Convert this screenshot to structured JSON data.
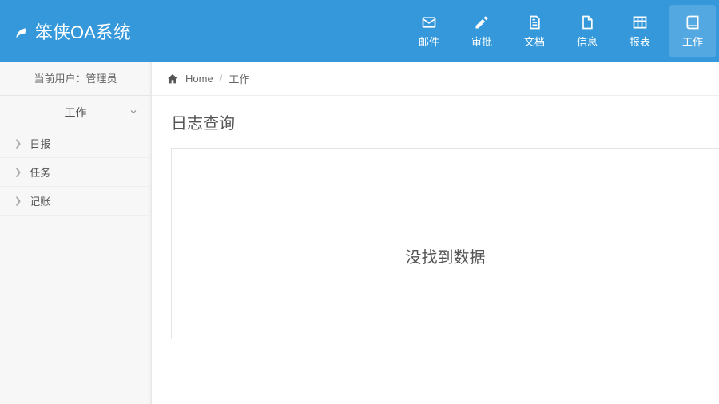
{
  "brand": {
    "title": "笨侠OA系统"
  },
  "nav": {
    "items": [
      {
        "label": "邮件",
        "icon": "mail"
      },
      {
        "label": "审批",
        "icon": "pencil"
      },
      {
        "label": "文档",
        "icon": "doc"
      },
      {
        "label": "信息",
        "icon": "file"
      },
      {
        "label": "报表",
        "icon": "table"
      },
      {
        "label": "工作",
        "icon": "book"
      }
    ],
    "active": 5
  },
  "sidebar": {
    "user_label": "当前用户：管理员",
    "section_label": "工作",
    "items": [
      {
        "label": "日报"
      },
      {
        "label": "任务"
      },
      {
        "label": "记账"
      }
    ]
  },
  "breadcrumb": {
    "home": "Home",
    "current": "工作"
  },
  "page": {
    "title": "日志查询",
    "empty": "没找到数据"
  }
}
